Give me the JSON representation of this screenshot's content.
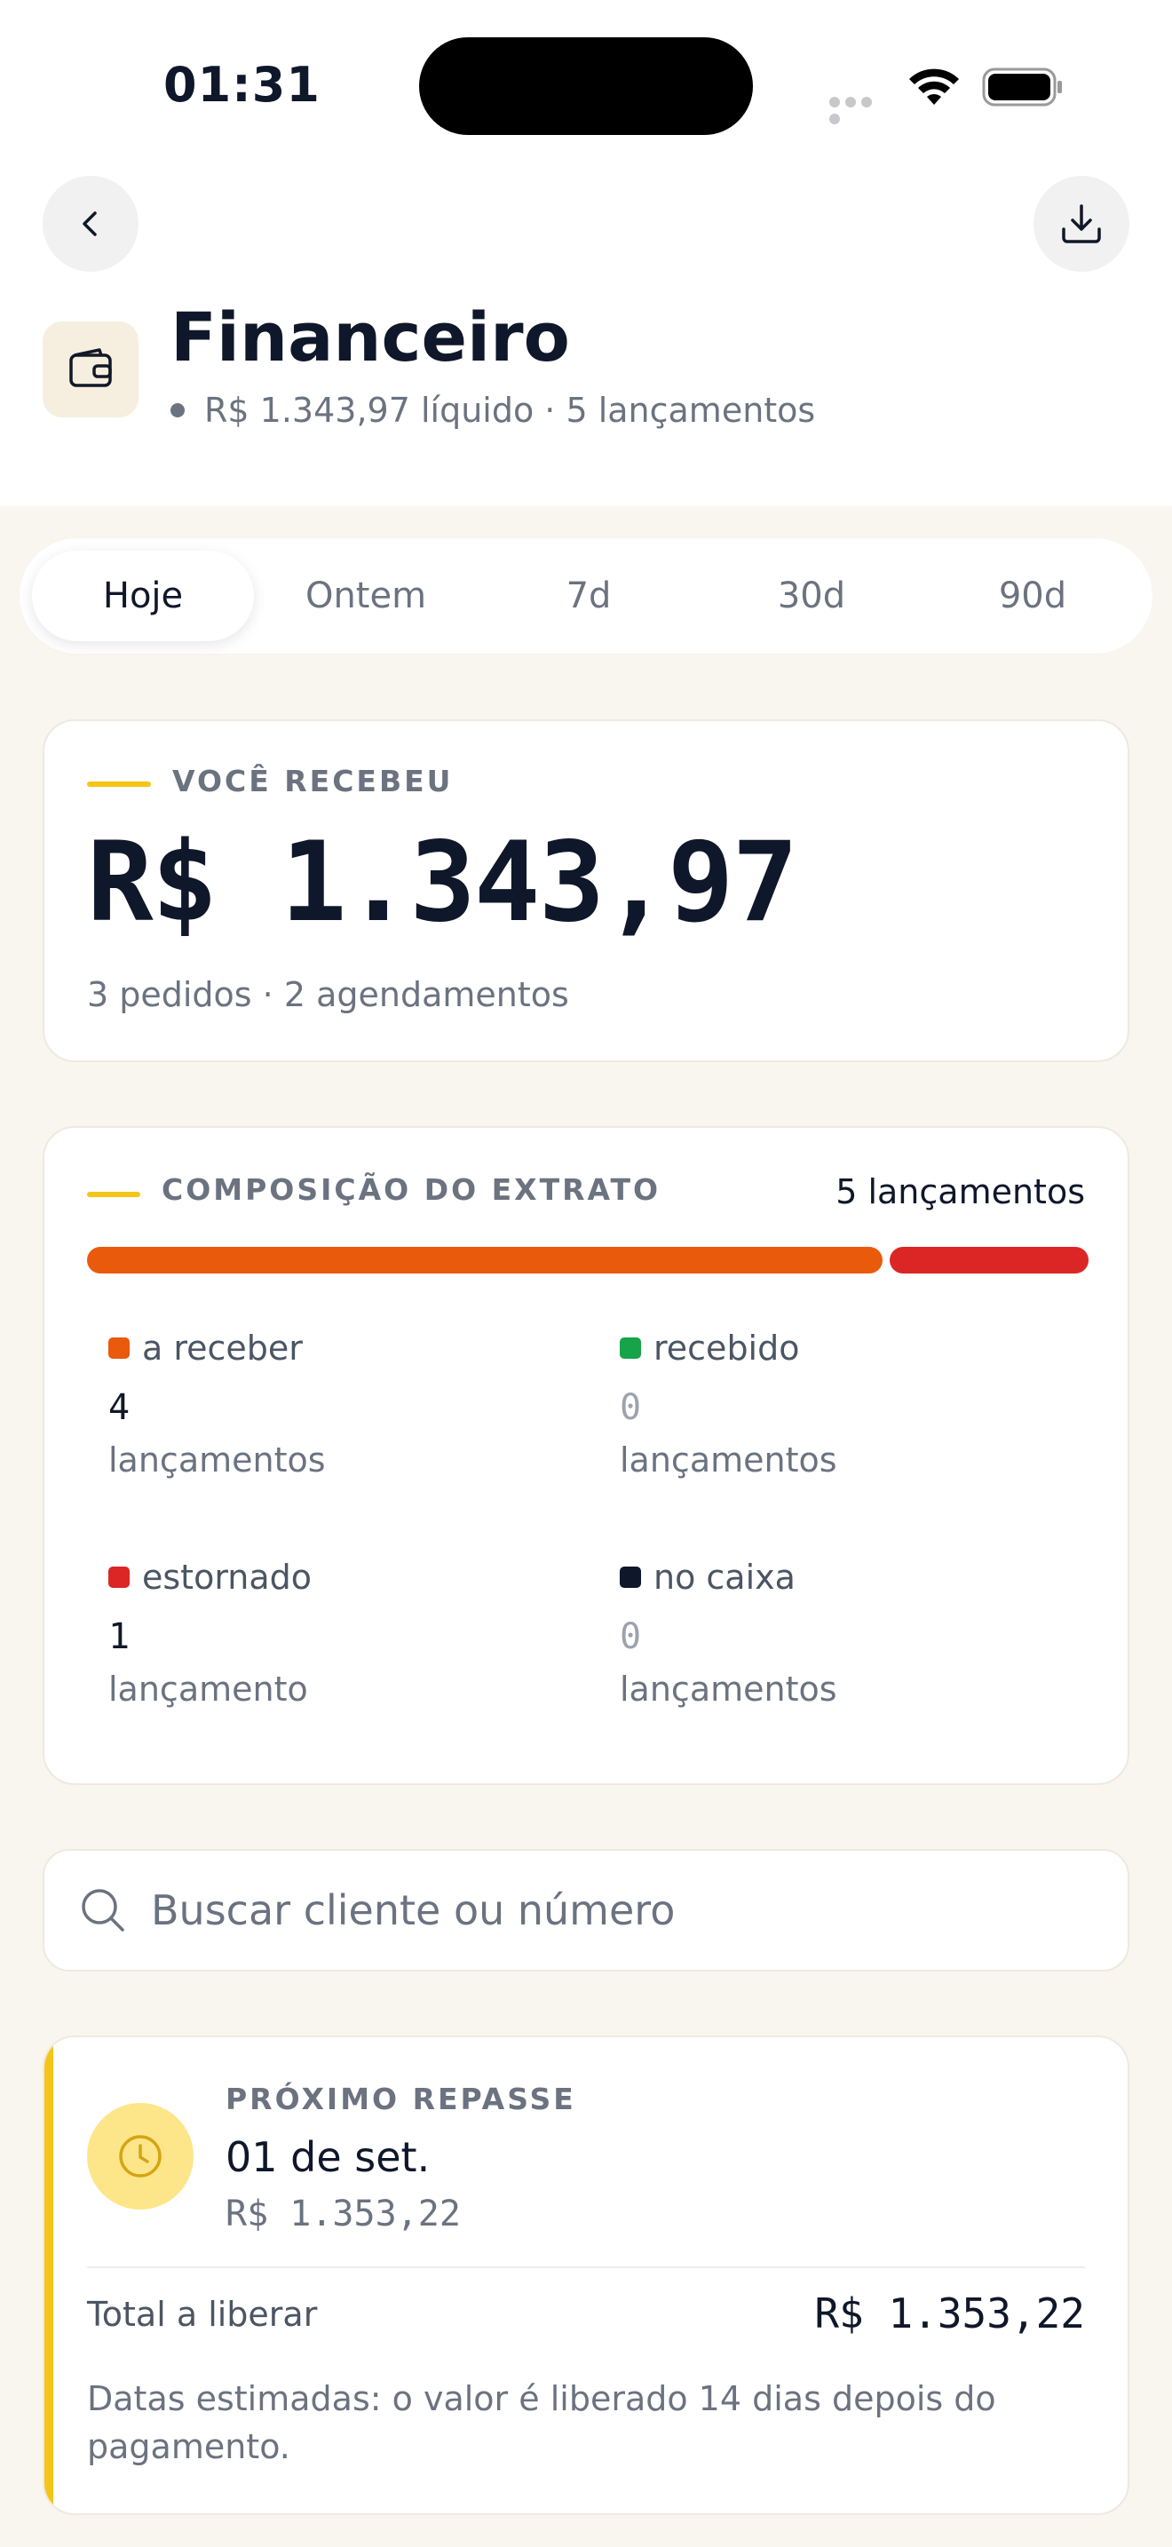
{
  "status_bar": {
    "time": "01:31"
  },
  "header": {
    "title": "Financeiro",
    "subtitle": "R$ 1.343,97 líquido · 5 lançamentos"
  },
  "tabs": [
    {
      "label": "Hoje",
      "active": true
    },
    {
      "label": "Ontem",
      "active": false
    },
    {
      "label": "7d",
      "active": false
    },
    {
      "label": "30d",
      "active": false
    },
    {
      "label": "90d",
      "active": false
    }
  ],
  "received": {
    "label": "VOCÊ RECEBEU",
    "amount": "R$ 1.343,97",
    "details": "3 pedidos · 2 agendamentos"
  },
  "composition": {
    "label": "COMPOSIÇÃO DO EXTRATO",
    "count": "5 lançamentos",
    "bar": [
      {
        "key": "a_receber",
        "fraction": 0.8,
        "color": "#ea5a0c"
      },
      {
        "key": "estornado",
        "fraction": 0.2,
        "color": "#dc2626"
      }
    ],
    "legend": [
      {
        "name": "a receber",
        "value": "4",
        "unit": "lançamentos",
        "color": "#ea5a0c"
      },
      {
        "name": "recebido",
        "value": "0",
        "unit": "lançamentos",
        "color": "#16a34a"
      },
      {
        "name": "estornado",
        "value": "1",
        "unit": "lançamento",
        "color": "#dc2626"
      },
      {
        "name": "no caixa",
        "value": "0",
        "unit": "lançamentos",
        "color": "#0f172a"
      }
    ]
  },
  "search": {
    "placeholder": "Buscar cliente ou número",
    "value": ""
  },
  "next_payout": {
    "label": "PRÓXIMO REPASSE",
    "date": "01 de set.",
    "amount": "R$ 1.353,22",
    "total_label": "Total a liberar",
    "total_value": "R$ 1.353,22",
    "note": "Datas estimadas: o valor é liberado 14 dias depois do pagamento."
  },
  "colors": {
    "accent": "#f5c518",
    "background": "#f9f5ef"
  }
}
